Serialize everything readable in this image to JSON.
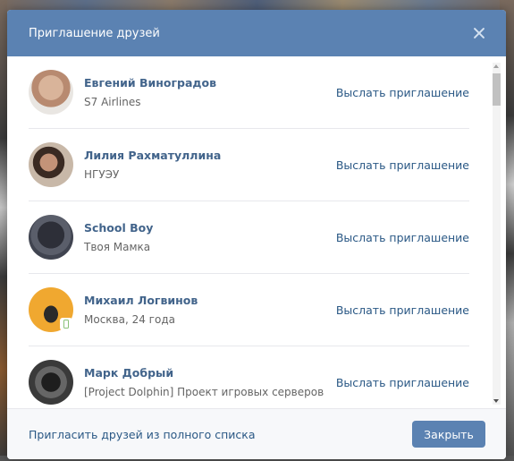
{
  "modal": {
    "title": "Приглашение друзей",
    "close_icon": "close-icon"
  },
  "friends": [
    {
      "name": "Евгений Виноградов",
      "subtitle": "S7 Airlines",
      "invite_label": "Выслать приглашение",
      "mobile": false
    },
    {
      "name": "Лилия Рахматуллина",
      "subtitle": "НГУЭУ",
      "invite_label": "Выслать приглашение",
      "mobile": false
    },
    {
      "name": "School Boy",
      "subtitle": "Твоя Мамка",
      "invite_label": "Выслать приглашение",
      "mobile": false
    },
    {
      "name": "Михаил Логвинов",
      "subtitle": "Москва, 24 года",
      "invite_label": "Выслать приглашение",
      "mobile": true
    },
    {
      "name": "Марк Добрый",
      "subtitle": "[Project Dolphin] Проект игровых серверов",
      "invite_label": "Выслать приглашение",
      "mobile": false
    }
  ],
  "footer": {
    "invite_all_link": "Пригласить друзей из полного списка",
    "close_button": "Закрыть"
  },
  "colors": {
    "header": "#5b82b2",
    "link": "#2a5885",
    "name": "#42648b",
    "button": "#5b82b2"
  }
}
